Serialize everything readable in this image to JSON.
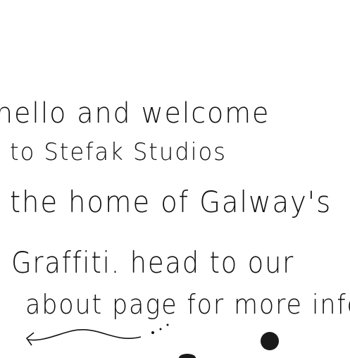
{
  "message": {
    "lines": [
      "hello and welcome",
      "to Stefak Studios",
      "the home of Galway's",
      "Graffiti. head to our",
      "about page for more info"
    ]
  },
  "ink_color": "#111111",
  "decorations": [
    "arrow-squiggle-icon",
    "ink-blot-icon"
  ]
}
